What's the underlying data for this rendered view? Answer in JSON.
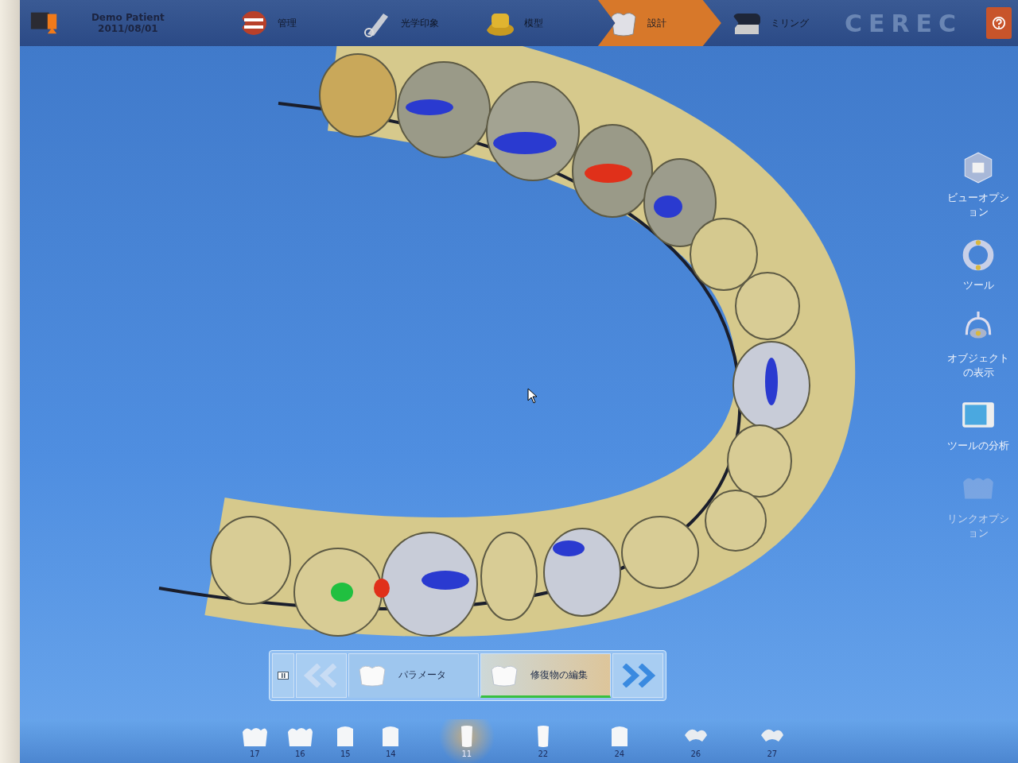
{
  "patient": {
    "name": "Demo Patient",
    "date": "2011/08/01"
  },
  "steps": [
    {
      "label": "管理",
      "kind": "jaw",
      "selected": false
    },
    {
      "label": "光学印象",
      "kind": "camera",
      "selected": false
    },
    {
      "label": "模型",
      "kind": "model",
      "selected": false
    },
    {
      "label": "設計",
      "kind": "crown",
      "selected": true
    },
    {
      "label": "ミリング",
      "kind": "mill",
      "selected": false
    }
  ],
  "logo": "CEREC",
  "tools": [
    {
      "label": "ビューオプション",
      "kind": "cube",
      "disabled": false
    },
    {
      "label": "ツール",
      "kind": "ring",
      "disabled": false
    },
    {
      "label": "オブジェクトの表示",
      "kind": "lamp",
      "disabled": false
    },
    {
      "label": "ツールの分析",
      "kind": "monitor",
      "disabled": false
    },
    {
      "label": "リンクオプション",
      "kind": "link",
      "disabled": true
    }
  ],
  "phases": [
    {
      "label": "パラメータ",
      "selected": false
    },
    {
      "label": "修復物の編集",
      "selected": true
    }
  ],
  "teeth": [
    {
      "number": "17",
      "kind": "molar",
      "selected": false
    },
    {
      "number": "16",
      "kind": "molar",
      "selected": false
    },
    {
      "number": "15",
      "kind": "premolar",
      "selected": false
    },
    {
      "number": "14",
      "kind": "premolar",
      "selected": false
    },
    {
      "number": "11",
      "kind": "incisor",
      "selected": true
    },
    {
      "number": "22",
      "kind": "incisor",
      "selected": false
    },
    {
      "number": "24",
      "kind": "premolar",
      "selected": false
    },
    {
      "number": "26",
      "kind": "inlay",
      "selected": false
    },
    {
      "number": "27",
      "kind": "inlay",
      "selected": false
    }
  ]
}
